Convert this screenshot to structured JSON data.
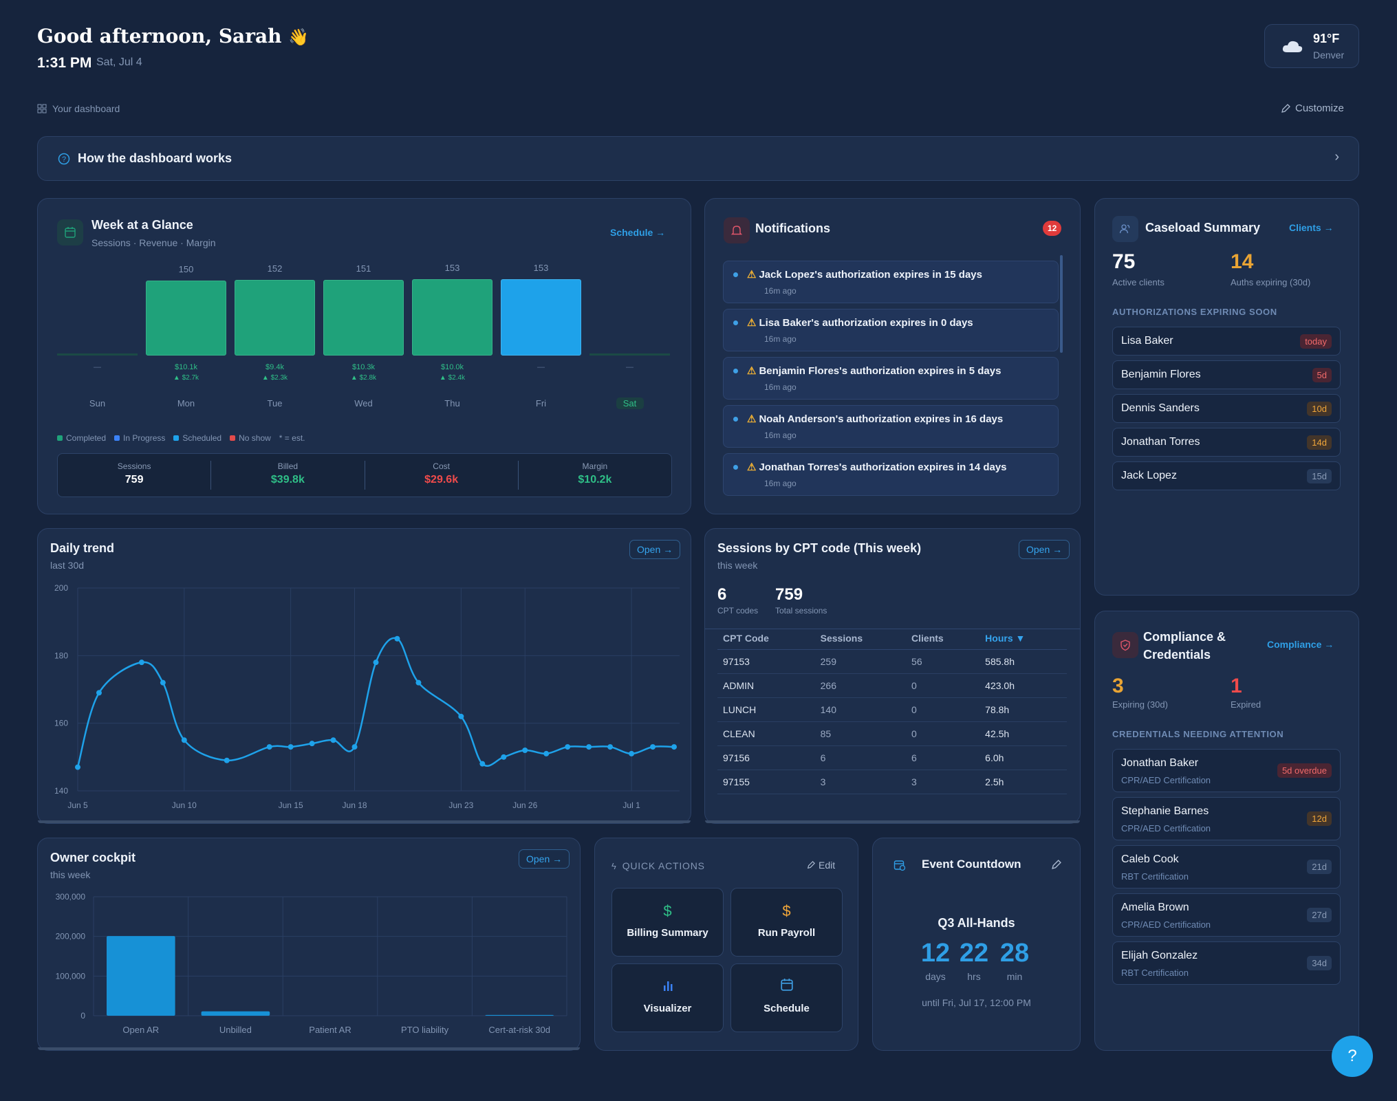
{
  "header": {
    "greeting": "Good afternoon, Sarah",
    "wave": "👋",
    "time": "1:31 PM",
    "date": "Sat, Jul 4",
    "weather_temp": "91°F",
    "weather_city": "Denver",
    "weather_icon": "cloud-icon"
  },
  "toolbar": {
    "your_dashboard": "Your dashboard",
    "customize": "Customize"
  },
  "howto": {
    "label": "How the dashboard works"
  },
  "week": {
    "title": "Week at a Glance",
    "subtitle": "Sessions · Revenue · Margin",
    "link": "Schedule →",
    "days": [
      {
        "day": "Sun",
        "sessions": "",
        "revenue": "—",
        "margin": "",
        "state": "empty"
      },
      {
        "day": "Mon",
        "sessions": "150",
        "revenue": "$10.1k",
        "margin": "▲ $2.7k",
        "state": "completed"
      },
      {
        "day": "Tue",
        "sessions": "152",
        "revenue": "$9.4k",
        "margin": "▲ $2.3k",
        "state": "completed"
      },
      {
        "day": "Wed",
        "sessions": "151",
        "revenue": "$10.3k",
        "margin": "▲ $2.8k",
        "state": "completed"
      },
      {
        "day": "Thu",
        "sessions": "153",
        "revenue": "$10.0k",
        "margin": "▲ $2.4k",
        "state": "completed"
      },
      {
        "day": "Fri",
        "sessions": "153",
        "revenue": "—",
        "margin": "",
        "state": "scheduled"
      },
      {
        "day": "Sat",
        "sessions": "",
        "revenue": "—",
        "margin": "",
        "state": "empty"
      }
    ],
    "legend": [
      {
        "label": "Completed",
        "color": "#1fa27a"
      },
      {
        "label": "In Progress",
        "color": "#3b82f6"
      },
      {
        "label": "Scheduled",
        "color": "#1ea2ea"
      },
      {
        "label": "No show",
        "color": "#e24b4b"
      }
    ],
    "legend_note": "* = est.",
    "stats": [
      {
        "label": "Sessions",
        "value": "759",
        "color": "#ffffff"
      },
      {
        "label": "Billed",
        "value": "$39.8k",
        "color": "#2fbf87"
      },
      {
        "label": "Cost",
        "value": "$29.6k",
        "color": "#ef4b4b"
      },
      {
        "label": "Margin",
        "value": "$10.2k",
        "color": "#2fbf87"
      }
    ]
  },
  "notifications": {
    "title": "Notifications",
    "count": "12",
    "items": [
      {
        "text": "Jack Lopez's authorization expires in 15 days",
        "time": "16m ago"
      },
      {
        "text": "Lisa Baker's authorization expires in 0 days",
        "time": "16m ago"
      },
      {
        "text": "Benjamin Flores's authorization expires in 5 days",
        "time": "16m ago"
      },
      {
        "text": "Noah Anderson's authorization expires in 16 days",
        "time": "16m ago"
      },
      {
        "text": "Jonathan Torres's authorization expires in 14 days",
        "time": "16m ago"
      }
    ]
  },
  "caseload": {
    "title": "Caseload Summary",
    "link": "Clients →",
    "active_value": "75",
    "active_label": "Active clients",
    "expiring_value": "14",
    "expiring_label": "Auths expiring (30d)",
    "section": "AUTHORIZATIONS EXPIRING SOON",
    "items": [
      {
        "name": "Lisa Baker",
        "badge": "today",
        "tone": "red"
      },
      {
        "name": "Benjamin Flores",
        "badge": "5d",
        "tone": "red"
      },
      {
        "name": "Dennis Sanders",
        "badge": "10d",
        "tone": "orange"
      },
      {
        "name": "Jonathan Torres",
        "badge": "14d",
        "tone": "orange"
      },
      {
        "name": "Jack Lopez",
        "badge": "15d",
        "tone": "gray"
      }
    ]
  },
  "daily_trend": {
    "title": "Daily trend",
    "subtitle": "last 30d",
    "open": "Open →"
  },
  "cpt": {
    "title": "Sessions by CPT code (This week)",
    "subtitle": "this week",
    "open": "Open →",
    "codes_value": "6",
    "codes_label": "CPT codes",
    "total_value": "759",
    "total_label": "Total sessions",
    "headers": [
      "CPT Code",
      "Sessions",
      "Clients",
      "Hours ▼"
    ],
    "rows": [
      [
        "97153",
        "259",
        "56",
        "585.8h"
      ],
      [
        "ADMIN",
        "266",
        "0",
        "423.0h"
      ],
      [
        "LUNCH",
        "140",
        "0",
        "78.8h"
      ],
      [
        "CLEAN",
        "85",
        "0",
        "42.5h"
      ],
      [
        "97156",
        "6",
        "6",
        "6.0h"
      ],
      [
        "97155",
        "3",
        "3",
        "2.5h"
      ]
    ]
  },
  "compliance": {
    "title_line1": "Compliance &",
    "title_line2": "Credentials",
    "link": "Compliance →",
    "expiring_value": "3",
    "expiring_label": "Expiring (30d)",
    "expired_value": "1",
    "expired_label": "Expired",
    "section": "CREDENTIALS NEEDING ATTENTION",
    "items": [
      {
        "name": "Jonathan Baker",
        "cert": "CPR/AED Certification",
        "badge": "5d overdue",
        "tone": "red"
      },
      {
        "name": "Stephanie Barnes",
        "cert": "CPR/AED Certification",
        "badge": "12d",
        "tone": "orange"
      },
      {
        "name": "Caleb Cook",
        "cert": "RBT Certification",
        "badge": "21d",
        "tone": "gray"
      },
      {
        "name": "Amelia Brown",
        "cert": "CPR/AED Certification",
        "badge": "27d",
        "tone": "gray"
      },
      {
        "name": "Elijah Gonzalez",
        "cert": "RBT Certification",
        "badge": "34d",
        "tone": "gray"
      }
    ]
  },
  "owner": {
    "title": "Owner cockpit",
    "subtitle": "this week",
    "open": "Open →"
  },
  "quick": {
    "title": "QUICK ACTIONS",
    "edit": "Edit",
    "actions": [
      {
        "label": "Billing Summary",
        "icon": "dollar-icon",
        "glyph": "$",
        "color": "#2fbf87"
      },
      {
        "label": "Run Payroll",
        "icon": "dollar-icon",
        "glyph": "$",
        "color": "#f0a63a"
      },
      {
        "label": "Visualizer",
        "icon": "bar-chart-icon",
        "glyph": "",
        "color": "#3b82f6"
      },
      {
        "label": "Schedule",
        "icon": "calendar-icon",
        "glyph": "",
        "color": "#3fa0e6"
      }
    ]
  },
  "countdown": {
    "title": "Event Countdown",
    "event": "Q3 All-Hands",
    "days": "12",
    "days_label": "days",
    "hrs": "22",
    "hrs_label": "hrs",
    "min": "28",
    "min_label": "min",
    "until": "until Fri, Jul 17, 12:00 PM"
  },
  "help": {
    "label": "?"
  },
  "chart_data": [
    {
      "type": "bar",
      "title": "Week at a Glance",
      "categories": [
        "Sun",
        "Mon",
        "Tue",
        "Wed",
        "Thu",
        "Fri",
        "Sat"
      ],
      "series": [
        {
          "name": "Completed",
          "values": [
            0,
            150,
            152,
            151,
            153,
            0,
            0
          ]
        },
        {
          "name": "Scheduled",
          "values": [
            0,
            0,
            0,
            0,
            0,
            153,
            0
          ]
        }
      ],
      "ylim": [
        0,
        153
      ]
    },
    {
      "type": "line",
      "title": "Daily trend",
      "x": [
        "Jun 5",
        "Jun 6",
        "Jun 8",
        "Jun 9",
        "Jun 10",
        "Jun 12",
        "Jun 14",
        "Jun 15",
        "Jun 16",
        "Jun 17",
        "Jun 18",
        "Jun 19",
        "Jun 20",
        "Jun 21",
        "Jun 23",
        "Jun 24",
        "Jun 25",
        "Jun 26",
        "Jun 27",
        "Jun 28",
        "Jun 29",
        "Jun 30",
        "Jul 1",
        "Jul 2",
        "Jul 3"
      ],
      "series": [
        {
          "values": [
            147,
            169,
            178,
            172,
            155,
            149,
            153,
            153,
            154,
            155,
            153,
            178,
            185,
            172,
            162,
            148,
            150,
            152,
            151,
            153,
            153,
            153,
            151,
            153,
            153
          ]
        }
      ],
      "xticks": [
        "Jun 5",
        "Jun 10",
        "Jun 15",
        "Jun 18",
        "Jun 23",
        "Jun 26",
        "Jul 1"
      ],
      "yticks": [
        140,
        160,
        180,
        200
      ],
      "ylim": [
        140,
        200
      ],
      "grid": true
    },
    {
      "type": "bar",
      "title": "Owner cockpit",
      "categories": [
        "Open AR",
        "Unbilled",
        "Patient AR",
        "PTO liability",
        "Cert-at-risk 30d"
      ],
      "values": [
        201000,
        11000,
        0,
        0,
        2000
      ],
      "yticks": [
        "0",
        "100,000",
        "200,000",
        "300,000"
      ],
      "ylim": [
        0,
        300000
      ],
      "grid": true
    }
  ]
}
